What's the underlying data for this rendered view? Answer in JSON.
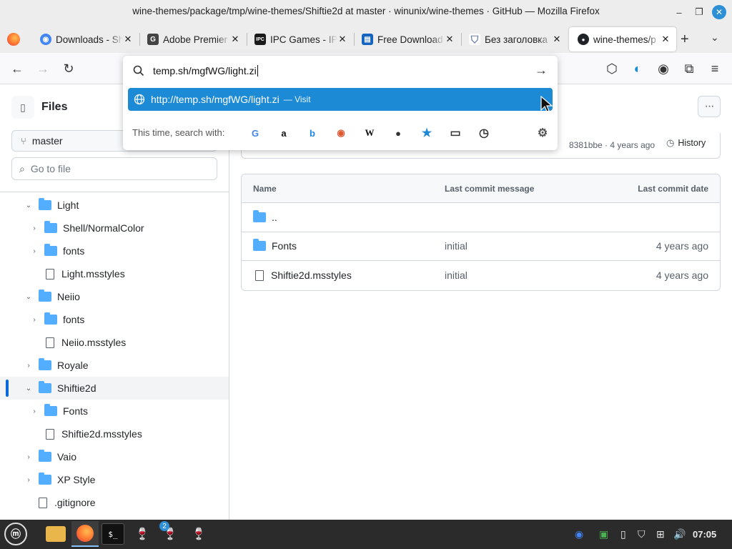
{
  "window": {
    "title": "wine-themes/package/tmp/wine-themes/Shiftie2d at master · winunix/wine-themes · GitHub — Mozilla Firefox",
    "minimize": "–",
    "maximize": "❐",
    "close": "✕"
  },
  "tabs": [
    {
      "label": "Downloads - Sh",
      "icon": "chrome-icon",
      "color": "#4285f4",
      "glyph": "◉",
      "active": false
    },
    {
      "label": "Adobe Premier",
      "icon": "getintopc-icon",
      "color": "#444444",
      "glyph": "G",
      "active": false
    },
    {
      "label": "IPC Games - IPC",
      "icon": "ipc-icon",
      "color": "#1a1a1a",
      "glyph": "IPC",
      "active": false
    },
    {
      "label": "Free Download",
      "icon": "download-site-icon",
      "color": "#1565c0",
      "glyph": "▤",
      "active": false
    },
    {
      "label": "Без заголовка",
      "icon": "shield-icon",
      "color": "#6b7fa8",
      "glyph": "⛉",
      "active": false
    },
    {
      "label": "wine-themes/p",
      "icon": "github-icon",
      "color": "#1f2328",
      "glyph": "●",
      "active": true
    }
  ],
  "tab_close": "✕",
  "tabbar": {
    "new_tab": "+",
    "list_all": "⌄"
  },
  "nav": {
    "back": "←",
    "forward": "→",
    "reload": "↻",
    "pocket": "⬡",
    "vpn": "◐",
    "account": "◉",
    "extensions": "⧉",
    "menu": "≡"
  },
  "urlbar": {
    "typed": "temp.sh/mgfWG/light.zi",
    "go": "→",
    "suggestion_url": "http://temp.sh/mgfWG/light.zi",
    "suggestion_action": "— Visit",
    "search_with_label": "This time, search with:",
    "engines": [
      {
        "name": "google-icon",
        "glyph": "G",
        "color": "#4285f4"
      },
      {
        "name": "amazon-icon",
        "glyph": "a",
        "color": "#111111"
      },
      {
        "name": "bing-icon",
        "glyph": "b",
        "color": "#1e88e5"
      },
      {
        "name": "duckduckgo-icon",
        "glyph": "◉",
        "color": "#de5833"
      },
      {
        "name": "wikipedia-icon",
        "glyph": "W",
        "color": "#111111"
      },
      {
        "name": "github-search-icon",
        "glyph": "●",
        "color": "#333333"
      },
      {
        "name": "bookmarks-icon",
        "glyph": "★",
        "color": "#1d8ad6"
      },
      {
        "name": "tabs-icon",
        "glyph": "▭",
        "color": "#333333"
      },
      {
        "name": "history-icon",
        "glyph": "◷",
        "color": "#333333"
      },
      {
        "name": "settings-icon",
        "glyph": "⚙",
        "color": "#555555"
      }
    ]
  },
  "sidebar": {
    "title": "Files",
    "branch": "master",
    "go_to_file_placeholder": "Go to file",
    "tree": [
      {
        "label": "Light",
        "type": "folder",
        "depth": 1,
        "chev": "⌄"
      },
      {
        "label": "Shell/NormalColor",
        "type": "folder",
        "depth": 2,
        "chev": "›"
      },
      {
        "label": "fonts",
        "type": "folder",
        "depth": 2,
        "chev": "›"
      },
      {
        "label": "Light.msstyles",
        "type": "file",
        "depth": 2,
        "chev": ""
      },
      {
        "label": "Neiio",
        "type": "folder",
        "depth": 1,
        "chev": "⌄"
      },
      {
        "label": "fonts",
        "type": "folder",
        "depth": 2,
        "chev": "›"
      },
      {
        "label": "Neiio.msstyles",
        "type": "file",
        "depth": 2,
        "chev": ""
      },
      {
        "label": "Royale",
        "type": "folder",
        "depth": 1,
        "chev": "›"
      },
      {
        "label": "Shiftie2d",
        "type": "folder",
        "depth": 1,
        "chev": "⌄",
        "selected": true
      },
      {
        "label": "Fonts",
        "type": "folder",
        "depth": 2,
        "chev": "›"
      },
      {
        "label": "Shiftie2d.msstyles",
        "type": "file",
        "depth": 2,
        "chev": ""
      },
      {
        "label": "Vaio",
        "type": "folder",
        "depth": 1,
        "chev": "›"
      },
      {
        "label": "XP Style",
        "type": "folder",
        "depth": 1,
        "chev": "›"
      },
      {
        "label": ".gitignore",
        "type": "file",
        "depth": 0,
        "chev": ""
      }
    ]
  },
  "main": {
    "more": "···",
    "commit": {
      "sha_age": "8381bbe · 4 years ago",
      "history": "History"
    },
    "table": {
      "headers": {
        "name": "Name",
        "message": "Last commit message",
        "date": "Last commit date"
      },
      "rows": [
        {
          "name": "..",
          "type": "folder",
          "message": "",
          "date": ""
        },
        {
          "name": "Fonts",
          "type": "folder",
          "message": "initial",
          "date": "4 years ago"
        },
        {
          "name": "Shiftie2d.msstyles",
          "type": "file",
          "message": "initial",
          "date": "4 years ago"
        }
      ]
    }
  },
  "taskbar": {
    "clock": "07:05",
    "badge": "2",
    "menu_glyph": "ⓜ",
    "apps": {
      "files": "📁",
      "firefox": "◉",
      "terminal": "$_",
      "wine1": "🍷",
      "wine2": "🍷",
      "wine3": "🍷"
    },
    "tray": {
      "chrome": "◉",
      "monitor": "▣",
      "clipboard": "▯",
      "shield": "⛉",
      "network": "⊞",
      "volume": "🔊"
    }
  },
  "colors": {
    "accent": "#1d8ad6",
    "folder": "#54aeff",
    "selected_bar": "#0969da"
  }
}
